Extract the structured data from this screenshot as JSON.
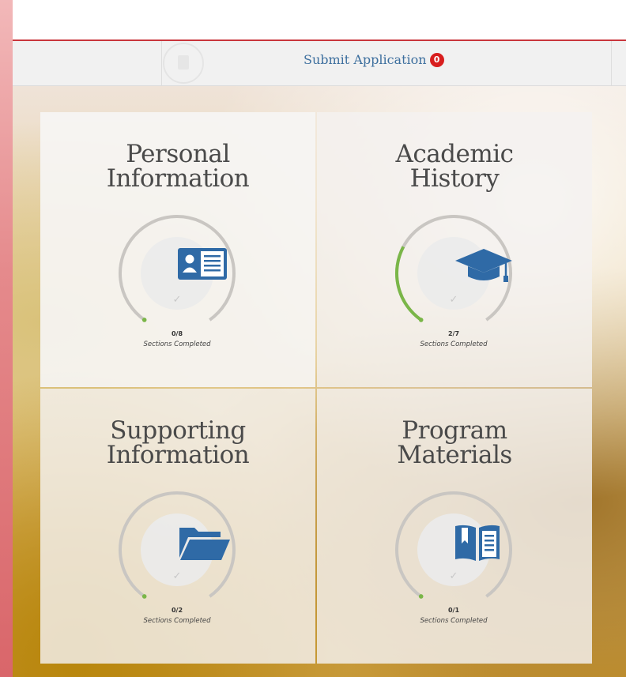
{
  "nav": {
    "submit_label": "Submit Application",
    "submit_badge": "0"
  },
  "cards": [
    {
      "title_line1": "Personal",
      "title_line2": "Information",
      "icon": "id-card-icon",
      "completed": 0,
      "total": 8,
      "count_text": "0/8",
      "label": "Sections Completed"
    },
    {
      "title_line1": "Academic",
      "title_line2": "History",
      "icon": "graduation-cap-icon",
      "completed": 2,
      "total": 7,
      "count_text": "2/7",
      "label": "Sections Completed"
    },
    {
      "title_line1": "Supporting",
      "title_line2": "Information",
      "icon": "folder-icon",
      "completed": 0,
      "total": 2,
      "count_text": "0/2",
      "label": "Sections Completed"
    },
    {
      "title_line1": "Program",
      "title_line2": "Materials",
      "icon": "book-icon",
      "completed": 0,
      "total": 1,
      "count_text": "0/1",
      "label": "Sections Completed"
    }
  ],
  "colors": {
    "accent_red": "#c9363c",
    "link_blue": "#3d6f9e",
    "icon_blue": "#2f6aa6",
    "progress_green": "#7ab648",
    "ring_gray": "#c9c6c2"
  }
}
